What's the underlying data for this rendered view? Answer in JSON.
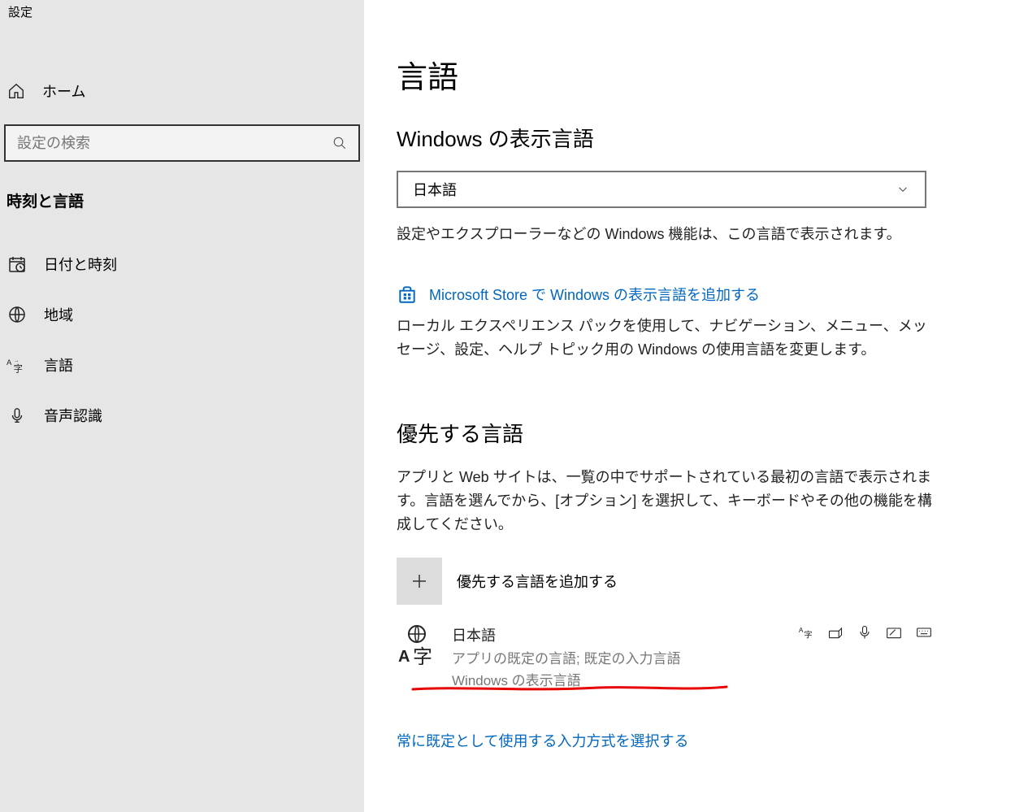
{
  "app_title": "設定",
  "sidebar": {
    "home_label": "ホーム",
    "search_placeholder": "設定の検索",
    "category_title": "時刻と言語",
    "items": [
      {
        "label": "日付と時刻"
      },
      {
        "label": "地域"
      },
      {
        "label": "言語"
      },
      {
        "label": "音声認識"
      }
    ]
  },
  "main": {
    "page_title": "言語",
    "display_lang_section_title": "Windows の表示言語",
    "display_lang_selected": "日本語",
    "display_lang_desc": "設定やエクスプローラーなどの Windows 機能は、この言語で表示されます。",
    "store_link_label": "Microsoft Store で Windows の表示言語を追加する",
    "store_link_desc": "ローカル エクスペリエンス パックを使用して、ナビゲーション、メニュー、メッセージ、設定、ヘルプ トピック用の Windows の使用言語を変更します。",
    "pref_lang_section_title": "優先する言語",
    "pref_lang_desc": "アプリと Web サイトは、一覧の中でサポートされている最初の言語で表示されます。言語を選んでから、[オプション] を選択して、キーボードやその他の機能を構成してください。",
    "add_lang_label": "優先する言語を追加する",
    "lang_entry": {
      "name": "日本語",
      "sub1": "アプリの既定の言語; 既定の入力言語",
      "sub2": "Windows の表示言語"
    },
    "input_method_link": "常に既定として使用する入力方式を選択する"
  }
}
